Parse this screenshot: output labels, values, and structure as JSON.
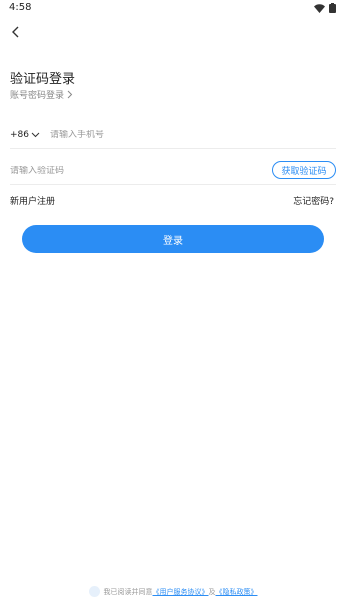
{
  "status_bar": {
    "time": "4:58"
  },
  "header": {
    "title": "验证码登录",
    "switch_mode": "账号密码登录"
  },
  "phone": {
    "country_code": "+86",
    "placeholder": "请输入手机号"
  },
  "code": {
    "placeholder": "请输入验证码",
    "get_code": "获取验证码"
  },
  "links": {
    "register": "新用户注册",
    "forgot": "忘记密码?"
  },
  "login_button": "登录",
  "agreement": {
    "prefix": "我已阅读并同意",
    "terms": "《用户服务协议》",
    "and": "及",
    "privacy": "《隐私政策》"
  },
  "colors": {
    "accent": "#2b8df4"
  },
  "icons": {
    "back": "chevron-left-icon",
    "wifi": "wifi-icon",
    "battery": "battery-icon"
  }
}
